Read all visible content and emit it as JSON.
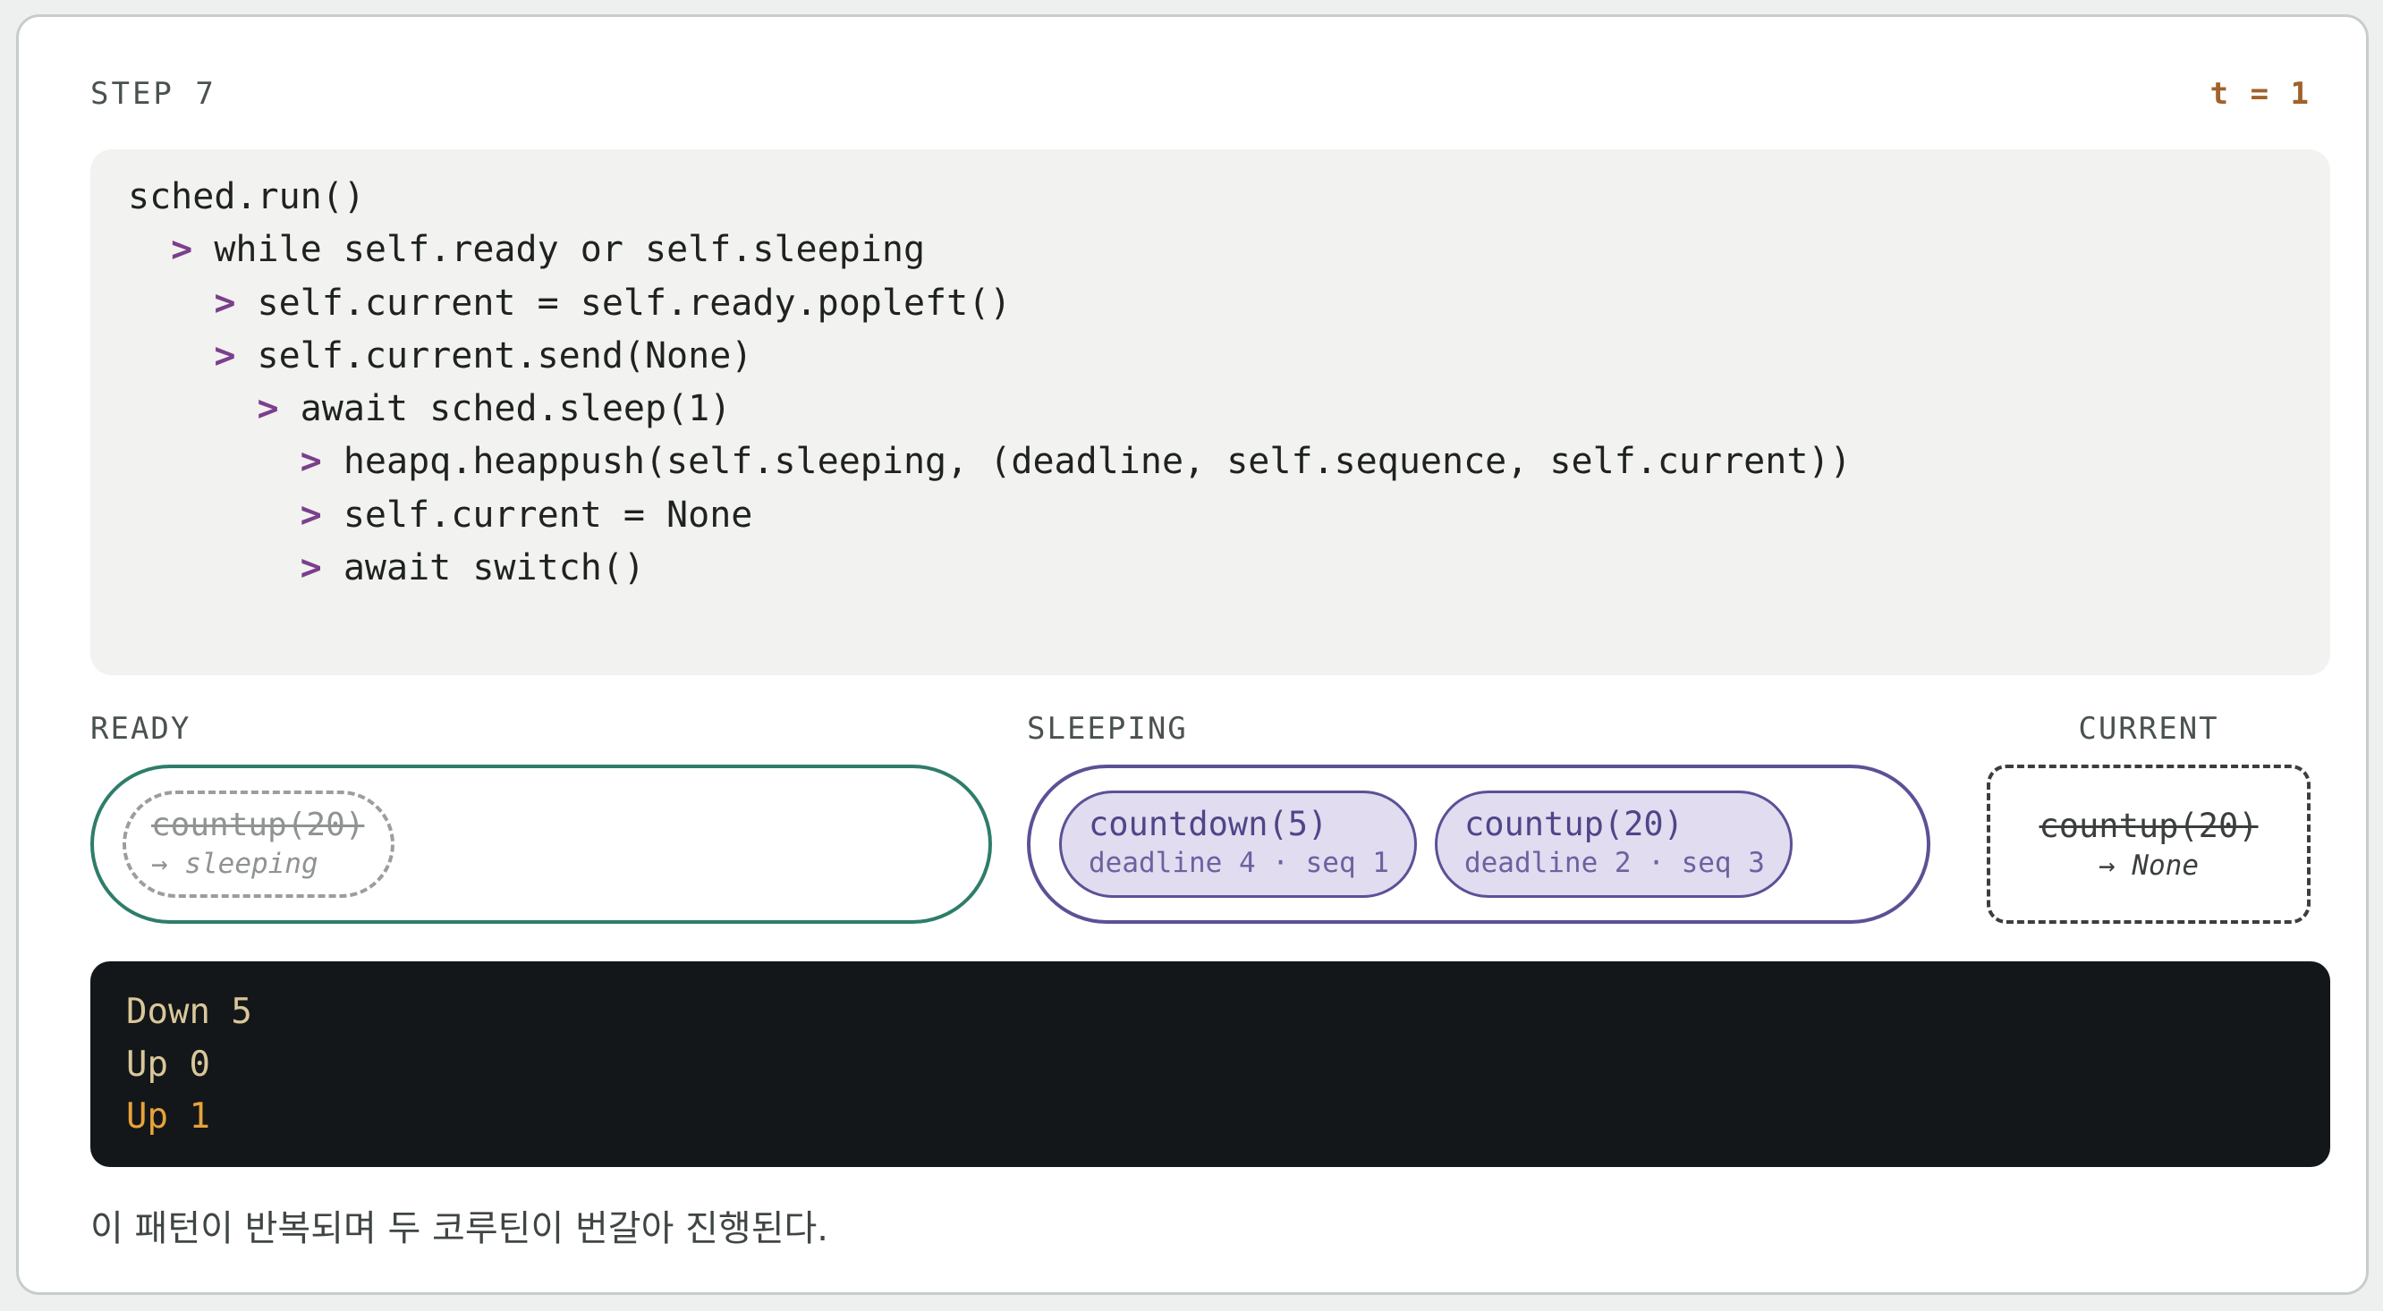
{
  "header": {
    "step": "STEP 7",
    "time": "t = 1"
  },
  "code": {
    "marker": ">",
    "lines": [
      {
        "indent": 0,
        "marked": false,
        "text": "sched.run()"
      },
      {
        "indent": 1,
        "marked": true,
        "text": "while self.ready or self.sleeping"
      },
      {
        "indent": 2,
        "marked": true,
        "text": "self.current = self.ready.popleft()"
      },
      {
        "indent": 2,
        "marked": true,
        "text": "self.current.send(None)"
      },
      {
        "indent": 3,
        "marked": true,
        "text": "await sched.sleep(1)"
      },
      {
        "indent": 4,
        "marked": true,
        "text": "heapq.heappush(self.sleeping, (deadline, self.sequence, self.current))"
      },
      {
        "indent": 4,
        "marked": true,
        "text": "self.current = None"
      },
      {
        "indent": 4,
        "marked": true,
        "text": "await switch()"
      }
    ]
  },
  "ready": {
    "label": "READY",
    "ghost_task": {
      "name": "countup(20)",
      "status": "→ sleeping"
    }
  },
  "sleeping": {
    "label": "SLEEPING",
    "tasks": [
      {
        "name": "countdown(5)",
        "detail": "deadline 4 · seq 1"
      },
      {
        "name": "countup(20)",
        "detail": "deadline 2 · seq 3"
      }
    ]
  },
  "current": {
    "label": "CURRENT",
    "name": "countup(20)",
    "status": "→ None"
  },
  "terminal": {
    "lines": [
      "Down 5",
      "Up 0",
      "Up 1"
    ],
    "latest_index": 2
  },
  "caption": "이 패턴이 반복되며 두 코루틴이 번갈아 진행된다.",
  "colors": {
    "ready_border": "#2e7d6a",
    "sleeping_border": "#5b5196",
    "marker": "#7b3f8c",
    "time": "#a0622a",
    "terminal_bg": "#141719",
    "terminal_latest": "#e8a23a"
  }
}
